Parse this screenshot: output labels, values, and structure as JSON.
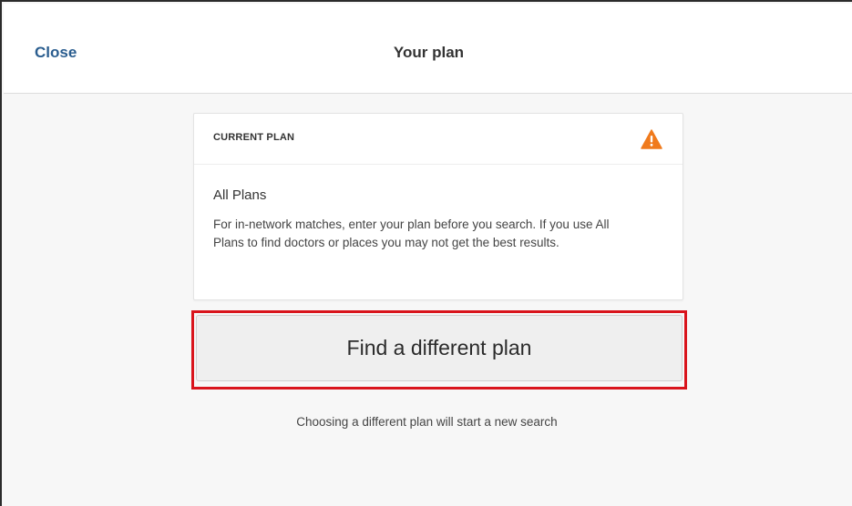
{
  "header": {
    "close_label": "Close",
    "title": "Your plan"
  },
  "card": {
    "section_label": "CURRENT PLAN",
    "warning_icon": "warning-triangle-icon",
    "warning_color": "#f07a1c",
    "plan_name": "All Plans",
    "description": "For in-network matches, enter your plan before you search. If you use All Plans to find doctors or places you may not get the best results."
  },
  "actions": {
    "find_plan_label": "Find a different plan",
    "note": "Choosing a different plan will start a new search"
  },
  "colors": {
    "link": "#2a5d8f",
    "highlight": "#d9141c",
    "background": "#f7f7f7"
  }
}
